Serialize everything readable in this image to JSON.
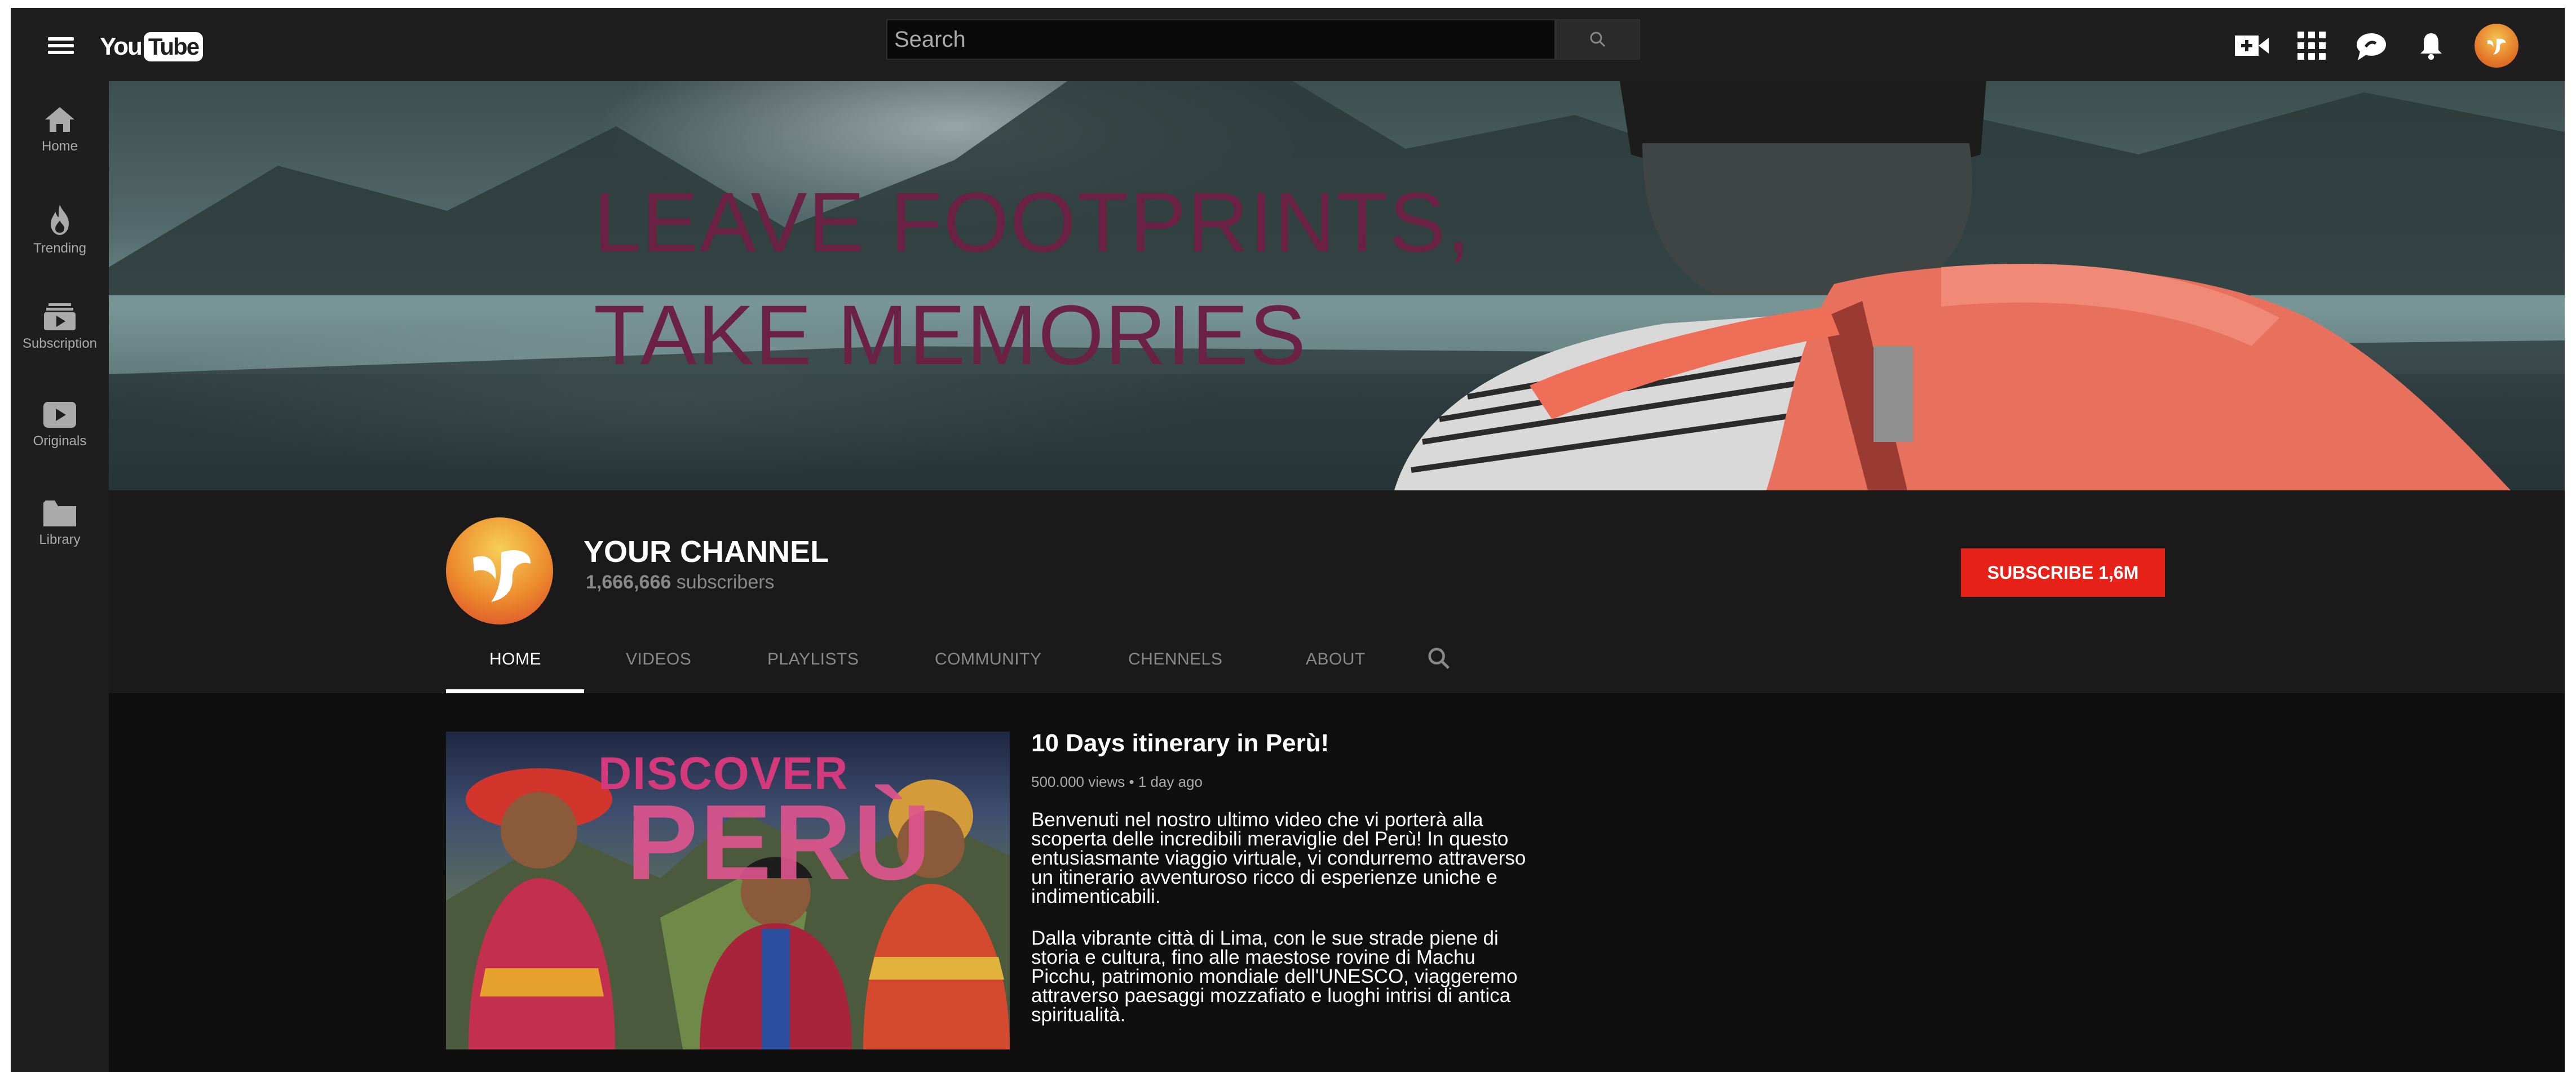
{
  "header": {
    "logo_you": "You",
    "logo_tube": "Tube",
    "search_placeholder": "Search",
    "icons": [
      "menu-icon",
      "search-icon",
      "create-video-icon",
      "apps-icon",
      "messages-icon",
      "notifications-icon",
      "account-avatar"
    ]
  },
  "sidebar": {
    "items": [
      {
        "label": "Home",
        "icon": "home-icon"
      },
      {
        "label": "Trending",
        "icon": "flame-icon"
      },
      {
        "label": "Subscription",
        "icon": "subscriptions-icon"
      },
      {
        "label": "Originals",
        "icon": "originals-icon"
      },
      {
        "label": "Library",
        "icon": "folder-icon"
      }
    ]
  },
  "banner": {
    "line1": "LEAVE FOOTPRINTS,",
    "line2": "TAKE MEMORIES"
  },
  "channel": {
    "name": "YOUR CHANNEL",
    "subs_count": "1,666,666",
    "subs_word": "subscribers",
    "subscribe_label": "SUBSCRIBE 1,6M"
  },
  "tabs": [
    {
      "label": "HOME",
      "active": true
    },
    {
      "label": "VIDEOS"
    },
    {
      "label": "PLAYLISTS"
    },
    {
      "label": "COMMUNITY"
    },
    {
      "label": "CHENNELS"
    },
    {
      "label": "ABOUT"
    }
  ],
  "video": {
    "thumb_line1": "DISCOVER",
    "thumb_line2": "PERÙ",
    "title": "10 Days itinerary in Perù!",
    "meta": "500.000 views • 1 day ago",
    "desc1": "Benvenuti nel nostro ultimo video che vi porterà alla scoperta delle incredibili meraviglie del Perù! In questo entusiasmante viaggio virtuale, vi condurremo attraverso un itinerario avventuroso ricco di esperienze uniche e indimenticabili.",
    "desc2": "Dalla vibrante città di Lima, con le sue strade piene di storia e cultura, fino alle maestose rovine di Machu Picchu, patrimonio mondiale dell'UNESCO, viaggeremo attraverso paesaggi mozzafiato e luoghi intrisi di antica spiritualità."
  },
  "colors": {
    "accent_red": "#e62117",
    "banner_text": "#6a2143",
    "background": "#0f0f0f",
    "surface": "#1e1e1e"
  }
}
